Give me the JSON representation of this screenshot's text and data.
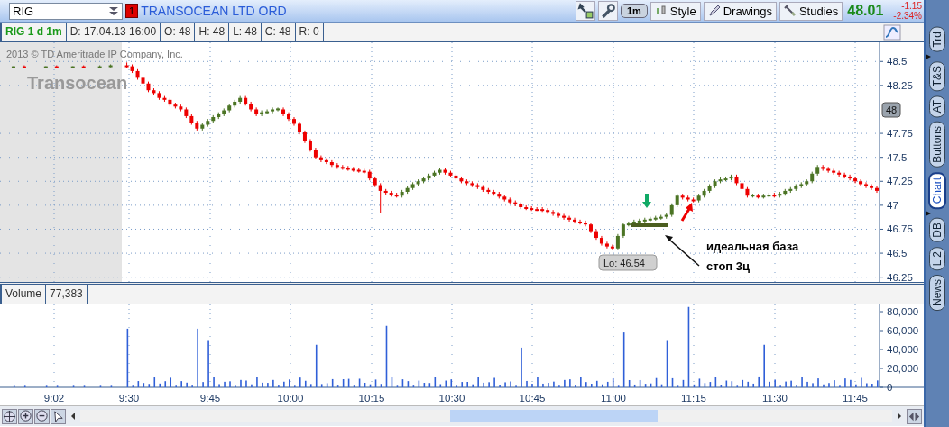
{
  "symbol_bar": {
    "symbol": "RIG",
    "alert_badge": "1",
    "company": "TRANSOCEAN LTD ORD",
    "timeframe_button": "1m",
    "buttons": [
      "Style",
      "Drawings",
      "Studies"
    ],
    "last_price": "48.01",
    "change": "-1.15",
    "change_percent": "-2.34%"
  },
  "info_row": {
    "chart_label": "RIG 1 d 1m",
    "fields": [
      "D: 17.04.13 16:00",
      "O: 48",
      "H: 48",
      "L: 48",
      "C: 48",
      "R: 0"
    ]
  },
  "price_chart": {
    "copyright": "2013 © TD Ameritrade IP Company, Inc.",
    "logo": "Transocean",
    "current_price_tag": "48",
    "low_label": "Lo: 46.54",
    "annotation_lines": [
      "идеальная база",
      "стоп 3ц"
    ],
    "chart_data": {
      "type": "candlestick",
      "grid": true,
      "ylim": [
        46.2,
        48.7
      ],
      "yticks": [
        {
          "value": 48.5,
          "label": "48.5"
        },
        {
          "value": 48.25,
          "label": "48.25"
        },
        {
          "value": 47.75,
          "label": "47.75"
        },
        {
          "value": 47.5,
          "label": "47.5"
        },
        {
          "value": 47.25,
          "label": "47.25"
        },
        {
          "value": 47,
          "label": "47"
        },
        {
          "value": 46.75,
          "label": "46.75"
        },
        {
          "value": 46.5,
          "label": "46.5"
        },
        {
          "value": 46.25,
          "label": "46.25"
        }
      ],
      "categories": [
        null,
        null,
        null,
        null,
        null,
        null,
        null,
        null,
        null,
        null,
        null,
        null,
        null,
        null,
        null,
        null,
        null,
        null,
        null,
        null,
        null,
        null,
        null,
        null,
        null,
        null,
        null,
        null,
        null,
        null,
        null,
        null,
        null,
        null,
        null,
        null,
        null,
        null,
        null,
        null,
        null,
        null,
        null,
        null,
        null,
        null,
        null,
        null,
        null,
        null,
        null,
        null,
        null,
        null,
        null,
        null,
        null,
        null,
        null,
        null,
        null,
        null,
        null,
        null,
        null,
        null,
        null,
        null,
        null,
        null,
        null,
        null,
        null,
        null,
        null,
        null,
        null,
        null,
        null,
        null,
        null,
        null,
        null,
        null,
        null,
        null,
        null,
        null,
        null,
        null,
        null,
        null,
        null,
        null,
        null,
        null,
        null,
        null,
        null,
        null,
        null,
        null,
        null,
        null,
        null,
        null,
        null,
        null,
        null,
        null,
        null,
        null,
        null,
        null,
        null,
        null,
        null,
        null,
        null,
        null,
        null,
        null,
        null,
        null,
        null,
        null,
        null,
        null,
        null,
        null,
        null,
        null,
        null,
        null,
        null,
        null,
        null,
        null,
        null,
        null,
        null,
        null,
        null,
        null,
        null,
        null,
        null,
        null,
        null,
        null,
        null,
        null,
        null,
        null,
        null,
        null,
        null,
        null,
        null,
        null,
        null,
        null,
        null
      ],
      "ohlc": [
        null,
        null,
        [
          48.44,
          48.45,
          48.43,
          48.45
        ],
        null,
        [
          48.45,
          48.46,
          48.44,
          48.44
        ],
        null,
        null,
        null,
        [
          48.44,
          48.45,
          48.43,
          48.45
        ],
        null,
        [
          48.45,
          48.46,
          48.44,
          48.44
        ],
        null,
        null,
        [
          48.44,
          48.45,
          48.43,
          48.45
        ],
        null,
        [
          48.45,
          48.46,
          48.44,
          48.44
        ],
        null,
        null,
        [
          48.44,
          48.46,
          48.43,
          48.45
        ],
        null,
        [
          48.45,
          48.47,
          48.44,
          48.46
        ],
        null,
        null,
        [
          48.46,
          48.49,
          48.43,
          48.45
        ],
        [
          48.45,
          48.47,
          48.38,
          48.4
        ],
        [
          48.4,
          48.42,
          48.31,
          48.33
        ],
        [
          48.33,
          48.35,
          48.25,
          48.27
        ],
        [
          48.27,
          48.29,
          48.18,
          48.2
        ],
        [
          48.2,
          48.22,
          48.15,
          48.17
        ],
        [
          48.17,
          48.19,
          48.1,
          48.12
        ],
        [
          48.12,
          48.14,
          48.08,
          48.1
        ],
        [
          48.1,
          48.12,
          48.03,
          48.05
        ],
        [
          48.05,
          48.07,
          48.01,
          48.03
        ],
        [
          48.03,
          48.05,
          47.98,
          48.0
        ],
        [
          48.0,
          48.02,
          47.91,
          47.93
        ],
        [
          47.93,
          47.95,
          47.84,
          47.86
        ],
        [
          47.86,
          47.88,
          47.78,
          47.8
        ],
        [
          47.8,
          47.86,
          47.78,
          47.84
        ],
        [
          47.84,
          47.9,
          47.82,
          47.88
        ],
        [
          47.88,
          47.94,
          47.86,
          47.92
        ],
        [
          47.92,
          47.97,
          47.9,
          47.95
        ],
        [
          47.95,
          48.01,
          47.93,
          47.99
        ],
        [
          47.99,
          48.06,
          47.97,
          48.04
        ],
        [
          48.04,
          48.1,
          48.02,
          48.08
        ],
        [
          48.08,
          48.14,
          48.06,
          48.12
        ],
        [
          48.12,
          48.14,
          48.04,
          48.06
        ],
        [
          48.06,
          48.08,
          47.98,
          48.0
        ],
        [
          48.0,
          48.02,
          47.93,
          47.95
        ],
        [
          47.95,
          47.99,
          47.93,
          47.97
        ],
        [
          47.97,
          48.0,
          47.95,
          47.98
        ],
        [
          47.98,
          48.02,
          47.96,
          48.0
        ],
        [
          48.0,
          48.02,
          47.98,
          48.01
        ],
        [
          48.0,
          48.02,
          47.93,
          47.95
        ],
        [
          47.95,
          47.97,
          47.88,
          47.9
        ],
        [
          47.9,
          47.92,
          47.83,
          47.85
        ],
        [
          47.85,
          47.87,
          47.74,
          47.76
        ],
        [
          47.76,
          47.78,
          47.65,
          47.67
        ],
        [
          47.67,
          47.69,
          47.56,
          47.58
        ],
        [
          47.58,
          47.6,
          47.48,
          47.5
        ],
        [
          47.5,
          47.52,
          47.45,
          47.47
        ],
        [
          47.47,
          47.49,
          47.43,
          47.45
        ],
        [
          47.45,
          47.47,
          47.4,
          47.42
        ],
        [
          47.42,
          47.44,
          47.38,
          47.4
        ],
        [
          47.4,
          47.42,
          47.37,
          47.39
        ],
        [
          47.39,
          47.41,
          47.36,
          47.38
        ],
        [
          47.38,
          47.4,
          47.35,
          47.37
        ],
        [
          47.37,
          47.39,
          47.34,
          47.36
        ],
        [
          47.36,
          47.38,
          47.33,
          47.35
        ],
        [
          47.35,
          47.37,
          47.26,
          47.28
        ],
        [
          47.28,
          47.3,
          47.19,
          47.21
        ],
        [
          47.21,
          47.23,
          46.92,
          47.15
        ],
        [
          47.15,
          47.17,
          47.11,
          47.13
        ],
        [
          47.13,
          47.15,
          47.09,
          47.11
        ],
        [
          47.11,
          47.13,
          47.08,
          47.1
        ],
        [
          47.1,
          47.16,
          47.08,
          47.14
        ],
        [
          47.14,
          47.2,
          47.12,
          47.18
        ],
        [
          47.18,
          47.24,
          47.16,
          47.22
        ],
        [
          47.22,
          47.27,
          47.2,
          47.25
        ],
        [
          47.25,
          47.3,
          47.23,
          47.28
        ],
        [
          47.28,
          47.33,
          47.26,
          47.31
        ],
        [
          47.31,
          47.36,
          47.29,
          47.34
        ],
        [
          47.34,
          47.39,
          47.32,
          47.37
        ],
        [
          47.37,
          47.39,
          47.32,
          47.34
        ],
        [
          47.34,
          47.36,
          47.29,
          47.31
        ],
        [
          47.31,
          47.33,
          47.26,
          47.28
        ],
        [
          47.28,
          47.3,
          47.23,
          47.25
        ],
        [
          47.25,
          47.27,
          47.21,
          47.23
        ],
        [
          47.23,
          47.25,
          47.19,
          47.21
        ],
        [
          47.21,
          47.23,
          47.17,
          47.19
        ],
        [
          47.19,
          47.21,
          47.14,
          47.16
        ],
        [
          47.16,
          47.18,
          47.12,
          47.14
        ],
        [
          47.14,
          47.16,
          47.1,
          47.12
        ],
        [
          47.12,
          47.14,
          47.07,
          47.09
        ],
        [
          47.09,
          47.11,
          47.04,
          47.06
        ],
        [
          47.06,
          47.08,
          47.01,
          47.03
        ],
        [
          47.03,
          47.05,
          46.99,
          47.01
        ],
        [
          47.01,
          47.03,
          46.96,
          46.98
        ],
        [
          46.98,
          47.0,
          46.95,
          46.97
        ],
        [
          46.97,
          46.99,
          46.94,
          46.96
        ],
        [
          46.96,
          46.98,
          46.94,
          46.95
        ],
        [
          46.96,
          46.98,
          46.93,
          46.95
        ],
        [
          46.95,
          46.97,
          46.91,
          46.93
        ],
        [
          46.93,
          46.95,
          46.89,
          46.91
        ],
        [
          46.91,
          46.93,
          46.87,
          46.89
        ],
        [
          46.89,
          46.91,
          46.85,
          46.87
        ],
        [
          46.87,
          46.89,
          46.83,
          46.85
        ],
        [
          46.85,
          46.87,
          46.81,
          46.83
        ],
        [
          46.83,
          46.85,
          46.8,
          46.82
        ],
        [
          46.82,
          46.84,
          46.78,
          46.8
        ],
        [
          46.8,
          46.82,
          46.71,
          46.73
        ],
        [
          46.73,
          46.75,
          46.64,
          46.66
        ],
        [
          46.66,
          46.68,
          46.58,
          46.6
        ],
        [
          46.6,
          46.62,
          46.55,
          46.57
        ],
        [
          46.57,
          46.59,
          46.54,
          46.55
        ],
        [
          46.55,
          46.7,
          46.54,
          46.68
        ],
        [
          46.68,
          46.82,
          46.66,
          46.8
        ],
        [
          46.8,
          46.83,
          46.78,
          46.81
        ],
        [
          46.81,
          46.85,
          46.79,
          46.83
        ],
        [
          46.83,
          46.86,
          46.81,
          46.84
        ],
        [
          46.84,
          46.87,
          46.82,
          46.85
        ],
        [
          46.85,
          46.88,
          46.83,
          46.86
        ],
        [
          46.86,
          46.89,
          46.84,
          46.87
        ],
        [
          46.87,
          46.9,
          46.85,
          46.88
        ],
        [
          46.88,
          46.92,
          46.86,
          46.9
        ],
        [
          46.9,
          47.02,
          46.88,
          47.0
        ],
        [
          47.0,
          47.12,
          46.98,
          47.1
        ],
        [
          47.1,
          47.12,
          47.06,
          47.08
        ],
        [
          47.08,
          47.1,
          47.04,
          47.06
        ],
        [
          47.06,
          47.08,
          47.03,
          47.05
        ],
        [
          47.05,
          47.12,
          47.03,
          47.1
        ],
        [
          47.1,
          47.17,
          47.08,
          47.15
        ],
        [
          47.15,
          47.22,
          47.13,
          47.2
        ],
        [
          47.2,
          47.27,
          47.18,
          47.25
        ],
        [
          47.25,
          47.29,
          47.23,
          47.27
        ],
        [
          47.27,
          47.3,
          47.25,
          47.28
        ],
        [
          47.28,
          47.32,
          47.26,
          47.3
        ],
        [
          47.3,
          47.32,
          47.21,
          47.23
        ],
        [
          47.23,
          47.25,
          47.15,
          47.17
        ],
        [
          47.17,
          47.19,
          47.08,
          47.1
        ],
        [
          47.1,
          47.12,
          47.08,
          47.11
        ],
        [
          47.1,
          47.12,
          47.07,
          47.09
        ],
        [
          47.09,
          47.12,
          47.07,
          47.1
        ],
        [
          47.1,
          47.13,
          47.08,
          47.11
        ],
        [
          47.11,
          47.13,
          47.08,
          47.1
        ],
        [
          47.1,
          47.14,
          47.08,
          47.12
        ],
        [
          47.12,
          47.17,
          47.1,
          47.15
        ],
        [
          47.15,
          47.19,
          47.13,
          47.17
        ],
        [
          47.17,
          47.22,
          47.15,
          47.2
        ],
        [
          47.2,
          47.24,
          47.18,
          47.22
        ],
        [
          47.22,
          47.27,
          47.2,
          47.25
        ],
        [
          47.25,
          47.35,
          47.23,
          47.33
        ],
        [
          47.33,
          47.42,
          47.31,
          47.4
        ],
        [
          47.4,
          47.42,
          47.36,
          47.38
        ],
        [
          47.38,
          47.4,
          47.34,
          47.36
        ],
        [
          47.36,
          47.38,
          47.32,
          47.34
        ],
        [
          47.34,
          47.36,
          47.3,
          47.32
        ],
        [
          47.32,
          47.34,
          47.28,
          47.3
        ],
        [
          47.3,
          47.32,
          47.26,
          47.28
        ],
        [
          47.28,
          47.3,
          47.23,
          47.25
        ],
        [
          47.25,
          47.27,
          47.2,
          47.22
        ],
        [
          47.22,
          47.24,
          47.18,
          47.2
        ],
        [
          47.2,
          47.22,
          47.16,
          47.18
        ],
        [
          47.18,
          47.2,
          47.13,
          47.15
        ]
      ]
    }
  },
  "time_axis": [
    "9:02",
    "9:30",
    "9:45",
    "10:00",
    "10:15",
    "10:30",
    "10:45",
    "11:00",
    "11:15",
    "11:30",
    "11:45"
  ],
  "volume_panel": {
    "title": "Volume",
    "value": "77,383",
    "y_ticks": [
      "80,000",
      "60,000",
      "40,000",
      "20,000",
      "0"
    ]
  },
  "side_tabs": [
    {
      "label": "Trd",
      "selected": false
    },
    {
      "label": "T&S",
      "selected": false
    },
    {
      "label": "AT",
      "selected": false
    },
    {
      "label": "Buttons",
      "selected": false
    },
    {
      "label": "Chart",
      "selected": true
    },
    {
      "label": "DB",
      "selected": false
    },
    {
      "label": "L 2",
      "selected": false
    },
    {
      "label": "News",
      "selected": false
    }
  ]
}
